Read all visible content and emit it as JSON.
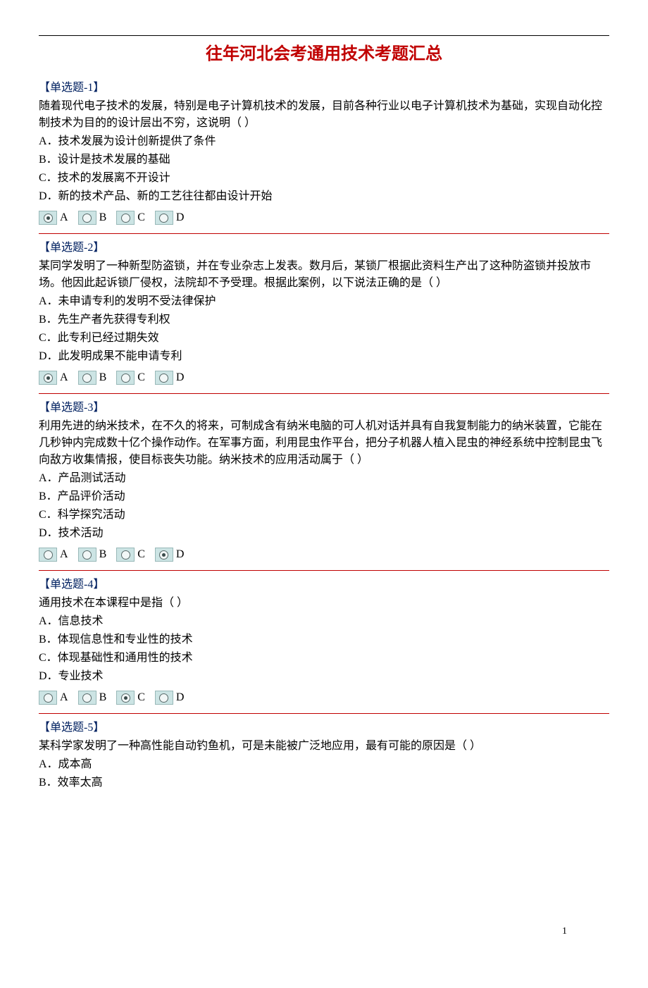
{
  "title": "往年河北会考通用技术考题汇总",
  "page_number": "1",
  "radio_letters": [
    "A",
    "B",
    "C",
    "D"
  ],
  "questions": [
    {
      "header": "【单选题-1】",
      "stem": "随着现代电子技术的发展，特别是电子计算机技术的发展，目前各种行业以电子计算机技术为基础，实现自动化控制技术为目的的设计层出不穷，这说明（ ）",
      "options": [
        "A．技术发展为设计创新提供了条件",
        "B．设计是技术发展的基础",
        "C．技术的发展离不开设计",
        "D．新的技术产品、新的工艺往往都由设计开始"
      ],
      "selected": 0
    },
    {
      "header": "【单选题-2】",
      "stem": "某同学发明了一种新型防盗锁，并在专业杂志上发表。数月后，某锁厂根据此资料生产出了这种防盗锁并投放市场。他因此起诉锁厂侵权，法院却不予受理。根据此案例，以下说法正确的是（ ）",
      "options": [
        "A．未申请专利的发明不受法律保护",
        "B．先生产者先获得专利权",
        "C．此专利已经过期失效",
        "D．此发明成果不能申请专利"
      ],
      "selected": 0
    },
    {
      "header": "【单选题-3】",
      "stem": "利用先进的纳米技术，在不久的将来，可制成含有纳米电脑的可人机对话并具有自我复制能力的纳米装置，它能在几秒钟内完成数十亿个操作动作。在军事方面，利用昆虫作平台，把分子机器人植入昆虫的神经系统中控制昆虫飞向敌方收集情报，使目标丧失功能。纳米技术的应用活动属于（ ）",
      "options": [
        "A．产品测试活动",
        "B．产品评价活动",
        "C．科学探究活动",
        "D．技术活动"
      ],
      "selected": 3
    },
    {
      "header": "【单选题-4】",
      "stem": "通用技术在本课程中是指（ ）",
      "options": [
        "A．信息技术",
        "B．体现信息性和专业性的技术",
        "C．体现基础性和通用性的技术",
        "D．专业技术"
      ],
      "selected": 2
    },
    {
      "header": "【单选题-5】",
      "stem": "某科学家发明了一种高性能自动钓鱼机，可是未能被广泛地应用，最有可能的原因是（ ）",
      "options": [
        "A．成本高",
        "B．效率太高"
      ],
      "selected": null,
      "no_radio_row": true,
      "no_hr": true
    }
  ]
}
